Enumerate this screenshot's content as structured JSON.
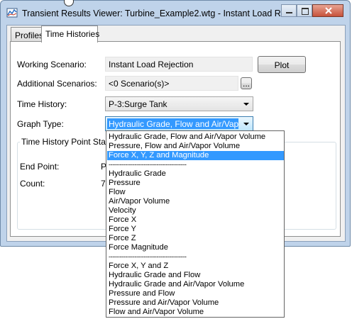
{
  "window": {
    "title": "Transient Results Viewer: Turbine_Example2.wtg - Instant Load R..."
  },
  "tabs": [
    {
      "label": "Profiles"
    },
    {
      "label": "Time Histories"
    }
  ],
  "form": {
    "working_scenario_label": "Working Scenario:",
    "working_scenario_value": "Instant Load Rejection",
    "plot_button": "Plot",
    "additional_scenarios_label": "Additional Scenarios:",
    "additional_scenarios_value": "<0 Scenario(s)>",
    "browse_button": "...",
    "time_history_label": "Time History:",
    "time_history_value": "P-3:Surge Tank",
    "graph_type_label": "Graph Type:",
    "graph_type_value": "Hydraulic Grade, Flow and Air/Vapor Vo"
  },
  "statistics": {
    "group_title": "Time History Point Statistic",
    "end_point_label": "End Point:",
    "end_point_value_partial": "P",
    "count_label": "Count:",
    "count_value_partial": "7"
  },
  "dropdown": {
    "selected_index": 2,
    "separator_text": "----------------------------------------------",
    "options": [
      "Hydraulic Grade, Flow and Air/Vapor Volume",
      "Pressure, Flow and Air/Vapor Volume",
      "Force X, Y, Z and Magnitude",
      "---",
      "Hydraulic Grade",
      "Pressure",
      "Flow",
      "Air/Vapor Volume",
      "Velocity",
      "Force X",
      "Force Y",
      "Force Z",
      "Force Magnitude",
      "---",
      "Force X, Y and Z",
      "Hydraulic Grade and Flow",
      "Hydraulic Grade and Air/Vapor Volume",
      "Pressure and Flow",
      "Pressure and Air/Vapor Volume",
      "Flow and Air/Vapor Volume"
    ]
  }
}
